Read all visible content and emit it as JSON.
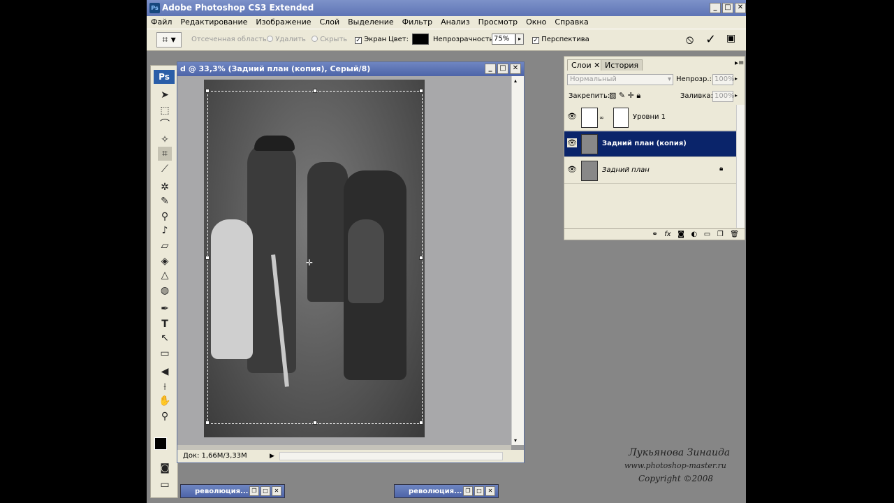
{
  "window": {
    "title": "Adobe Photoshop CS3 Extended",
    "app_icon": "Ps"
  },
  "menu": [
    "Файл",
    "Редактирование",
    "Изображение",
    "Слой",
    "Выделение",
    "Фильтр",
    "Анализ",
    "Просмотр",
    "Окно",
    "Справка"
  ],
  "options": {
    "cropped_area_label": "Отсеченная область:",
    "delete_label": "Удалить",
    "hide_label": "Скрыть",
    "screen_label": "Экран",
    "color_label": "Цвет:",
    "opacity_label": "Непрозрачность:",
    "opacity_value": "75%",
    "perspective_label": "Перспектива"
  },
  "tools": {
    "logo": "Ps"
  },
  "document": {
    "title": "d @ 33,3% (Задний план (копия), Серый/8)",
    "status": "Док: 1,66M/3,33M"
  },
  "layers_panel": {
    "tab_layers": "Слои",
    "tab_history": "История",
    "blend_mode": "Нормальный",
    "opacity_label": "Непрозр.:",
    "opacity_value": "100%",
    "lock_label": "Закрепить:",
    "fill_label": "Заливка:",
    "fill_value": "100%",
    "layers": [
      {
        "name": "Уровни 1"
      },
      {
        "name": "Задний план (копия)"
      },
      {
        "name": "Задний план"
      }
    ]
  },
  "watermark": {
    "author": "Лукьянова Зинаида",
    "site": "www.photoshop-master.ru",
    "copyright": "Copyright ©2008"
  },
  "taskbar": [
    {
      "label": "революция..."
    },
    {
      "label": "революция..."
    }
  ]
}
